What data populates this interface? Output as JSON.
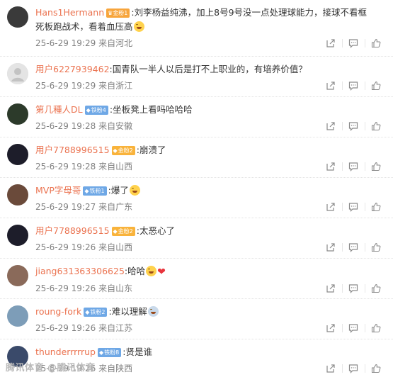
{
  "comments": [
    {
      "user": "Hans1Hermann",
      "badge_type": "crown",
      "badge": "金粉1",
      "text": "刘李杨益纯沸，加上8号9号没一点处理球能力，接球不看框死板跑战术，看着血压高",
      "emojis": [
        "grin"
      ],
      "time": "25-6-29 19:29",
      "location": "来自河北",
      "avatar_color": "#3a3a3a"
    },
    {
      "user": "用户6227939462",
      "badge_type": "none",
      "badge": "",
      "text": "国青队一半人以后是打不上职业的，有培养价值？",
      "emojis": [],
      "time": "25-6-29 19:29",
      "location": "来自浙江",
      "avatar_color": "#d6d6d6"
    },
    {
      "user": "第几種人DL",
      "badge_type": "blue",
      "badge": "铁粉4",
      "text": "坐板凳上看吗哈哈哈",
      "emojis": [],
      "time": "25-6-29 19:28",
      "location": "来自安徽",
      "avatar_color": "#2c3a2a"
    },
    {
      "user": "用户7788996515",
      "badge_type": "gold",
      "badge": "金粉2",
      "text": "崩溃了",
      "emojis": [],
      "time": "25-6-29 19:28",
      "location": "来自山西",
      "avatar_color": "#1d1d2a"
    },
    {
      "user": "MVP字母哥",
      "badge_type": "blue",
      "badge": "铁粉1",
      "text": "爆了",
      "emojis": [
        "laugh"
      ],
      "time": "25-6-29 19:27",
      "location": "来自广东",
      "avatar_color": "#6a4a3a"
    },
    {
      "user": "用户7788996515",
      "badge_type": "gold",
      "badge": "金粉2",
      "text": "太恶心了",
      "emojis": [],
      "time": "25-6-29 19:26",
      "location": "来自山西",
      "avatar_color": "#1d1d2a"
    },
    {
      "user": "jiang631363306625",
      "badge_type": "none",
      "badge": "",
      "text": "哈哈",
      "emojis": [
        "laugh",
        "heart"
      ],
      "time": "25-6-29 19:26",
      "location": "来自山东",
      "avatar_color": "#8a6a5a"
    },
    {
      "user": "roung-fork",
      "badge_type": "blue",
      "badge": "铁粉2",
      "text": "难以理解",
      "emojis": [
        "shock"
      ],
      "time": "25-6-29 19:26",
      "location": "来自江苏",
      "avatar_color": "#7d9db8"
    },
    {
      "user": "thunderrrrrup",
      "badge_type": "blue",
      "badge": "铁粉8",
      "text": "贤是谁",
      "emojis": [],
      "time": "25-6-29 19:26",
      "location": "来自陕西",
      "avatar_color": "#3a4a6a"
    }
  ],
  "icons": {
    "share": "share-icon",
    "comment": "comment-icon",
    "like": "like-icon"
  },
  "watermark": "腾讯体育 @腾讯体育"
}
